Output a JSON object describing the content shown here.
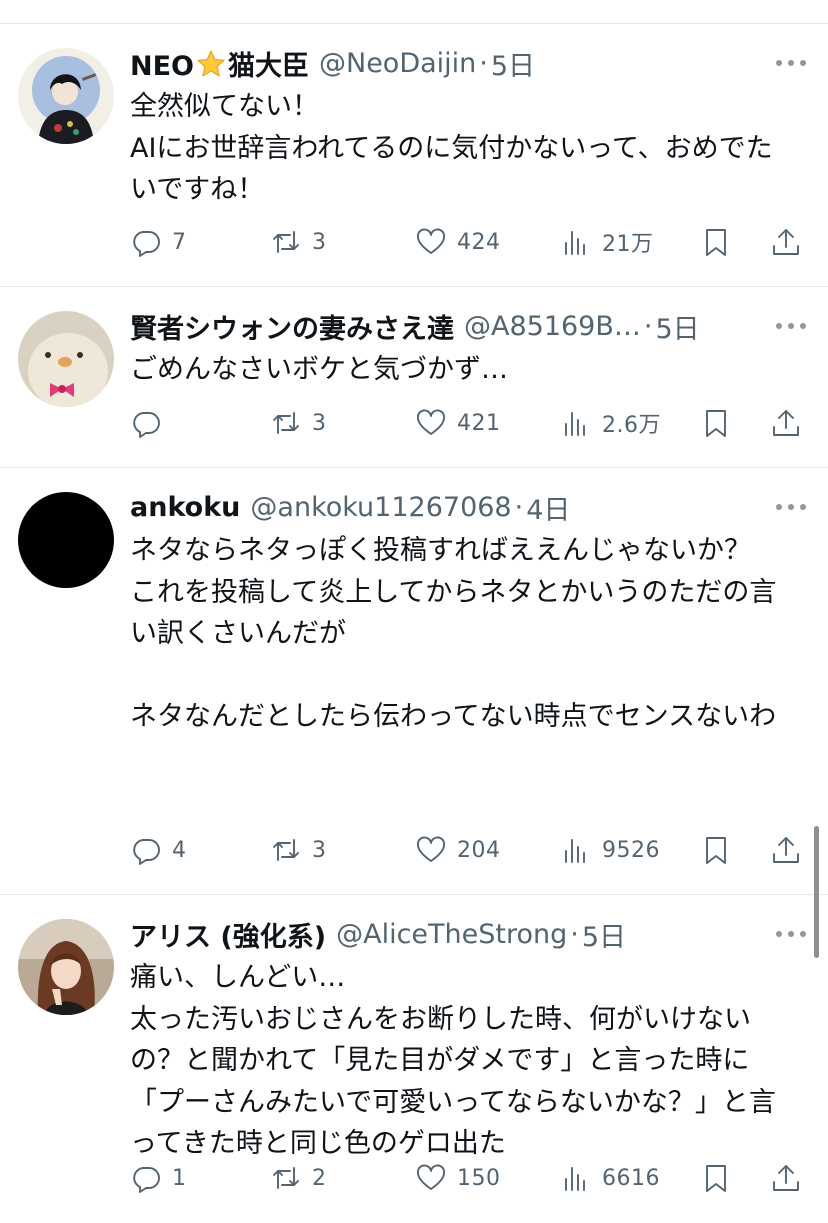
{
  "tweets": [
    {
      "name": "NEO",
      "name_emoji": "⭐",
      "name_suffix": "猫大臣",
      "handle": "@NeoDaijin",
      "time": "5日",
      "text": "全然似てない！\nAIにお世辞言われてるのに気付かないって、おめでたいですね！",
      "replies": "7",
      "retweets": "3",
      "likes": "424",
      "views": "21万"
    },
    {
      "name": "賢者シウォンの妻みさえ達",
      "handle": "@A85169B…",
      "time": "5日",
      "text": "ごめんなさいボケと気づかず…",
      "replies": "",
      "retweets": "3",
      "likes": "421",
      "views": "2.6万"
    },
    {
      "name": "ankoku",
      "handle": "@ankoku11267068",
      "time": "4日",
      "text": "ネタならネタっぽく投稿すればええんじゃないか？\nこれを投稿して炎上してからネタとかいうのただの言い訳くさいんだが\n\nネタなんだとしたら伝わってない時点でセンスないわ",
      "replies": "4",
      "retweets": "3",
      "likes": "204",
      "views": "9526"
    },
    {
      "name": "アリス (強化系)",
      "handle": "@AliceTheStrong",
      "time": "5日",
      "text": "痛い、しんどい…\n太った汚いおじさんをお断りした時、何がいけないの？と聞かれて「見た目がダメです」と言った時に「プーさんみたいで可愛いってならないかな？」と言ってきた時と同じ色のゲロ出た",
      "replies": "1",
      "retweets": "2",
      "likes": "150",
      "views": "6616"
    }
  ],
  "separator": "·",
  "icons": {
    "reply": "reply-icon",
    "retweet": "retweet-icon",
    "like": "heart-icon",
    "views": "views-icon",
    "bookmark": "bookmark-icon",
    "share": "share-icon",
    "more": "more-icon"
  },
  "colors": {
    "text": "#0f1419",
    "secondary": "#536471",
    "divider": "#e6e8eb"
  }
}
